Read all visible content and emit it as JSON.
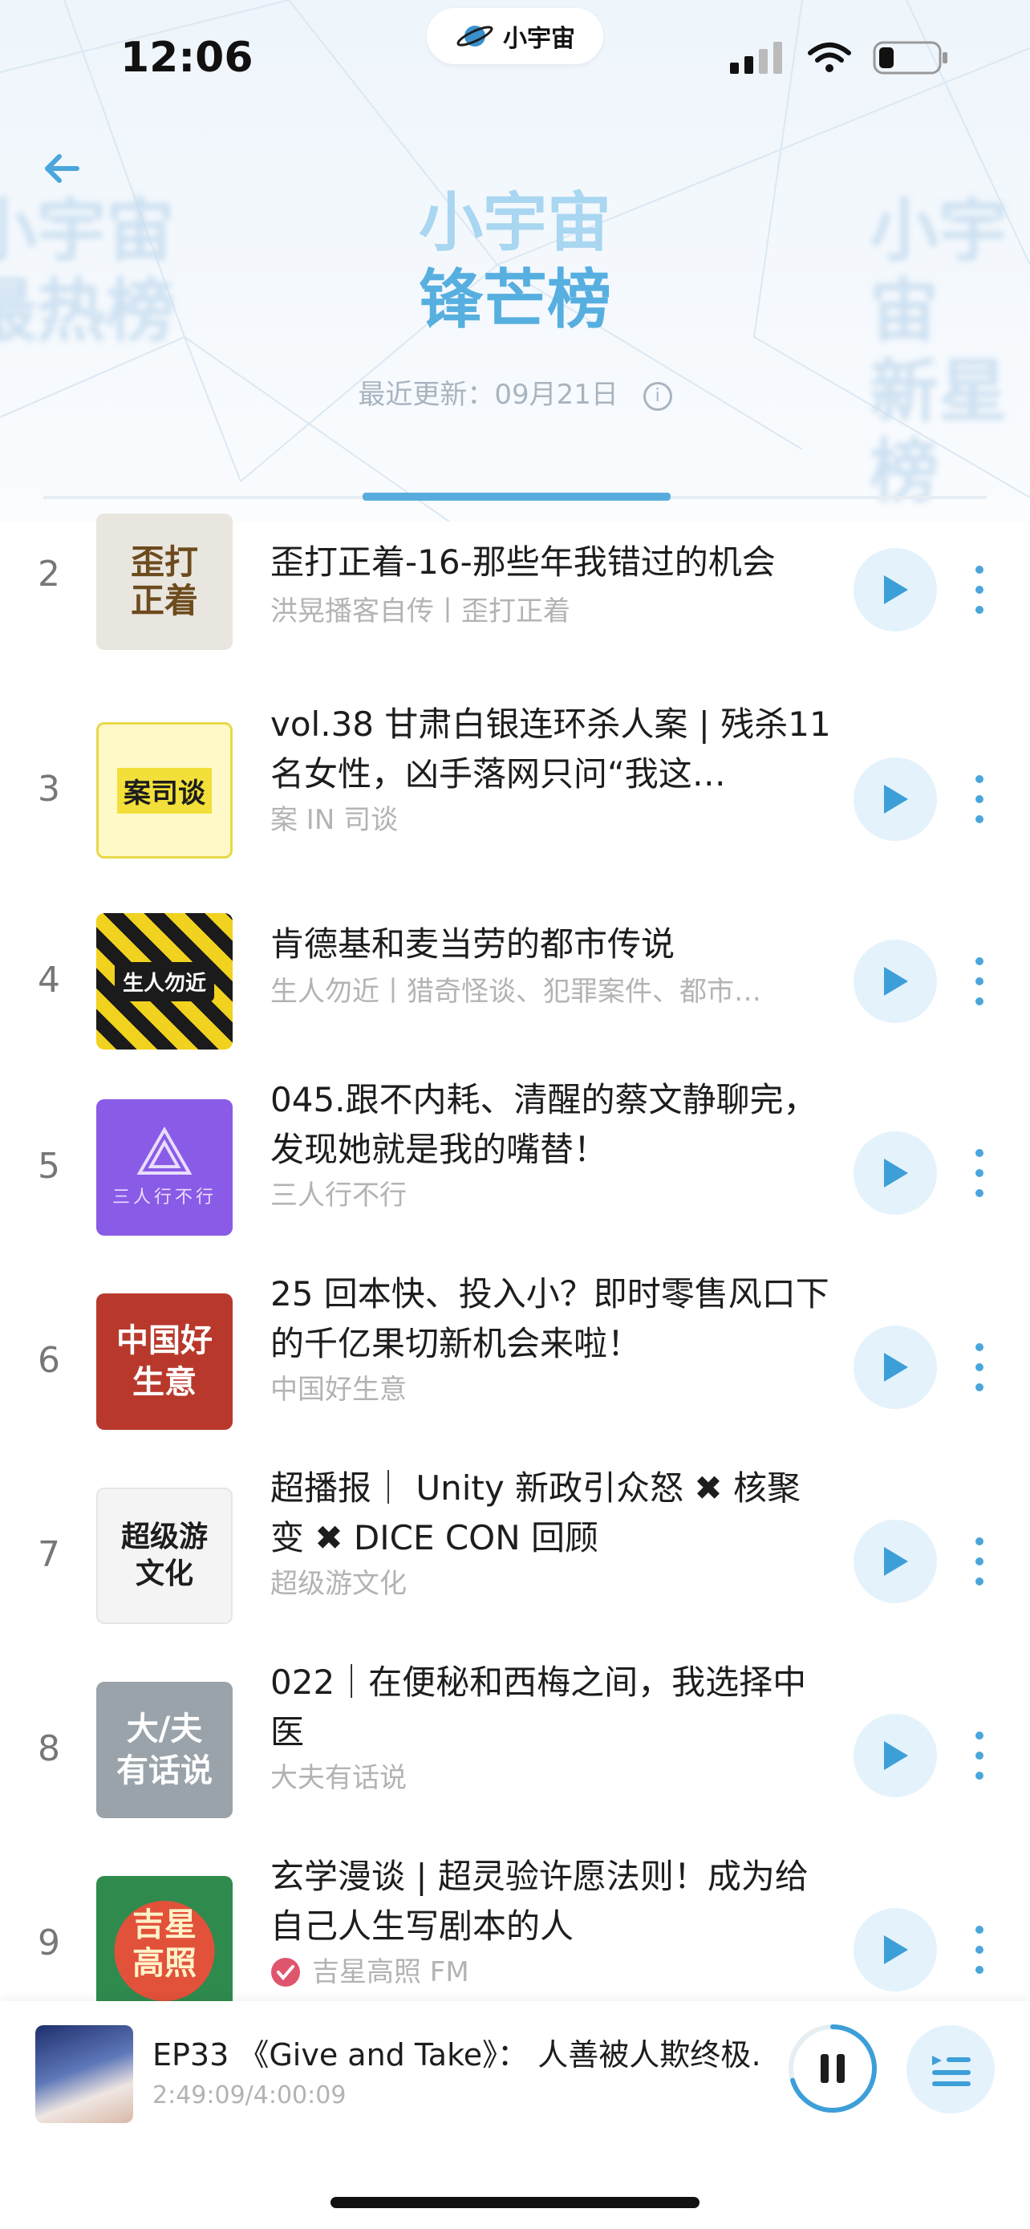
{
  "status_bar": {
    "time": "12:06",
    "brand": "小宇宙"
  },
  "header": {
    "title_line1": "小宇宙",
    "title_line2": "锋芒榜",
    "left_ghost": "小宇宙\n最热榜",
    "right_ghost": "小宇宙\n新星榜",
    "updated": "最近更新：09月21日"
  },
  "rows": [
    {
      "rank": "2",
      "title": "歪打正着-16-那些年我错过的机会",
      "sub": "洪晃播客自传丨歪打正着",
      "cover_text": "歪打正着"
    },
    {
      "rank": "3",
      "title": "vol.38 甘肃白银连环杀人案 | 残杀11名女性，凶手落网只问“我这…",
      "sub": "案 IN 司谈",
      "cover_text": "案司谈"
    },
    {
      "rank": "4",
      "title": "肯德基和麦当劳的都市传说",
      "sub": "生人勿近丨猎奇怪谈、犯罪案件、都市…",
      "cover_text": "生人勿近"
    },
    {
      "rank": "5",
      "title": "045.跟不内耗、清醒的蔡文静聊完，发现她就是我的嘴替！",
      "sub": "三人行不行",
      "cover_text": "三人行不行"
    },
    {
      "rank": "6",
      "title": "25 回本快、投入小？即时零售风口下的千亿果切新机会来啦！",
      "sub": "中国好生意",
      "cover_text": "中国好生意"
    },
    {
      "rank": "7",
      "title": "超播报｜ Unity 新政引众怒 ✖ 核聚变 ✖ DICE CON 回顾",
      "sub": "超级游文化",
      "cover_text": "超级游文化"
    },
    {
      "rank": "8",
      "title": "022｜在便秘和西梅之间，我选择中医",
      "sub": "大夫有话说",
      "cover_text": "大/夫有话说"
    },
    {
      "rank": "9",
      "title": "玄学漫谈 | 超灵验许愿法则！成为给自己人生写剧本的人",
      "sub": "吉星高照 FM",
      "cover_text": "吉星高照"
    }
  ],
  "player": {
    "episode": "EP33 《Give and Take》： 人善被人欺终极…",
    "time": "2:49:09/4:00:09",
    "progress": 0.704
  },
  "colors": {
    "accent": "#58acdd",
    "play_bg": "#e4f2fb"
  }
}
